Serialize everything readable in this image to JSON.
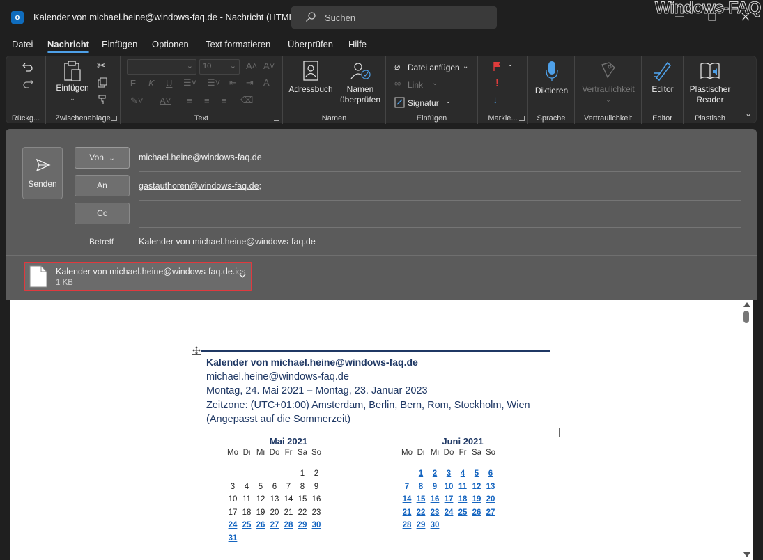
{
  "window": {
    "title": "Kalender von michael.heine@windows-faq.de  -  Nachricht (HTML)",
    "search_placeholder": "Suchen",
    "watermark": "Windows-FAQ"
  },
  "tabs": [
    "Datei",
    "Nachricht",
    "Einfügen",
    "Optionen",
    "Text formatieren",
    "Überprüfen",
    "Hilfe"
  ],
  "active_tab": "Nachricht",
  "ribbon": {
    "groups": {
      "undo": "Rückg...",
      "clipboard": "Zwischenablage",
      "text": "Text",
      "names": "Namen",
      "include": "Einfügen",
      "tags": "Markie...",
      "voice": "Sprache",
      "sensitivity": "Vertraulichkeit",
      "editor": "Editor",
      "immersive": "Plastisch"
    },
    "buttons": {
      "paste": "Einfügen",
      "font_size": "10",
      "addressbook": "Adressbuch",
      "check_names_1": "Namen",
      "check_names_2": "überprüfen",
      "attach_file": "Datei anfügen",
      "link": "Link",
      "signature": "Signatur",
      "dictate": "Diktieren",
      "sensitivity": "Vertraulichkeit",
      "editor": "Editor",
      "reader_1": "Plastischer",
      "reader_2": "Reader"
    }
  },
  "compose": {
    "send_label": "Senden",
    "from_label": "Von",
    "from_value": "michael.heine@windows-faq.de",
    "to_label": "An",
    "to_value": "gastauthoren@windows-faq.de;",
    "cc_label": "Cc",
    "cc_value": "",
    "subject_label": "Betreff",
    "subject_value": "Kalender von michael.heine@windows-faq.de"
  },
  "attachment": {
    "name": "Kalender von michael.heine@windows-faq.de.ics",
    "size": "1 KB"
  },
  "calendar": {
    "title": "Kalender von michael.heine@windows-faq.de",
    "owner": "michael.heine@windows-faq.de",
    "range": "Montag, 24. Mai 2021 – Montag, 23. Januar 2023",
    "timezone": "Zeitzone: (UTC+01:00) Amsterdam, Berlin, Bern, Rom, Stockholm, Wien",
    "timezone_note": "(Angepasst auf die Sommerzeit)",
    "weekdays": [
      "Mo",
      "Di",
      "Mi",
      "Do",
      "Fr",
      "Sa",
      "So"
    ],
    "months": [
      {
        "name": "Mai 2021",
        "weeks": [
          [
            {
              "d": ""
            },
            {
              "d": ""
            },
            {
              "d": ""
            },
            {
              "d": ""
            },
            {
              "d": ""
            },
            {
              "d": "1"
            },
            {
              "d": "2"
            }
          ],
          [
            {
              "d": "3"
            },
            {
              "d": "4"
            },
            {
              "d": "5"
            },
            {
              "d": "6"
            },
            {
              "d": "7"
            },
            {
              "d": "8"
            },
            {
              "d": "9"
            }
          ],
          [
            {
              "d": "10"
            },
            {
              "d": "11"
            },
            {
              "d": "12"
            },
            {
              "d": "13"
            },
            {
              "d": "14"
            },
            {
              "d": "15"
            },
            {
              "d": "16"
            }
          ],
          [
            {
              "d": "17"
            },
            {
              "d": "18"
            },
            {
              "d": "19"
            },
            {
              "d": "20"
            },
            {
              "d": "21"
            },
            {
              "d": "22"
            },
            {
              "d": "23"
            }
          ],
          [
            {
              "d": "24",
              "busy": true
            },
            {
              "d": "25",
              "busy": true
            },
            {
              "d": "26",
              "busy": true
            },
            {
              "d": "27",
              "busy": true
            },
            {
              "d": "28",
              "busy": true
            },
            {
              "d": "29",
              "busy": true
            },
            {
              "d": "30",
              "busy": true
            }
          ],
          [
            {
              "d": "31",
              "busy": true
            },
            {
              "d": ""
            },
            {
              "d": ""
            },
            {
              "d": ""
            },
            {
              "d": ""
            },
            {
              "d": ""
            },
            {
              "d": ""
            }
          ]
        ]
      },
      {
        "name": "Juni 2021",
        "weeks": [
          [
            {
              "d": ""
            },
            {
              "d": "1",
              "busy": true
            },
            {
              "d": "2",
              "busy": true
            },
            {
              "d": "3",
              "busy": true
            },
            {
              "d": "4",
              "busy": true
            },
            {
              "d": "5",
              "busy": true
            },
            {
              "d": "6",
              "busy": true
            }
          ],
          [
            {
              "d": "7",
              "busy": true
            },
            {
              "d": "8",
              "busy": true
            },
            {
              "d": "9",
              "busy": true
            },
            {
              "d": "10",
              "busy": true
            },
            {
              "d": "11",
              "busy": true
            },
            {
              "d": "12",
              "busy": true
            },
            {
              "d": "13",
              "busy": true
            }
          ],
          [
            {
              "d": "14",
              "busy": true
            },
            {
              "d": "15",
              "busy": true
            },
            {
              "d": "16",
              "busy": true
            },
            {
              "d": "17",
              "busy": true
            },
            {
              "d": "18",
              "busy": true
            },
            {
              "d": "19",
              "busy": true
            },
            {
              "d": "20",
              "busy": true
            }
          ],
          [
            {
              "d": "21",
              "busy": true
            },
            {
              "d": "22",
              "busy": true
            },
            {
              "d": "23",
              "busy": true
            },
            {
              "d": "24",
              "busy": true
            },
            {
              "d": "25",
              "busy": true
            },
            {
              "d": "26",
              "busy": true
            },
            {
              "d": "27",
              "busy": true
            }
          ],
          [
            {
              "d": "28",
              "busy": true
            },
            {
              "d": "29",
              "busy": true
            },
            {
              "d": "30",
              "busy": true
            },
            {
              "d": ""
            },
            {
              "d": ""
            },
            {
              "d": ""
            },
            {
              "d": ""
            }
          ]
        ]
      }
    ]
  },
  "colors": {
    "accent": "#4ea0e8",
    "calendar_text": "#1f3864",
    "busy_day": "#1565c0",
    "highlight_border": "#e0393e"
  }
}
